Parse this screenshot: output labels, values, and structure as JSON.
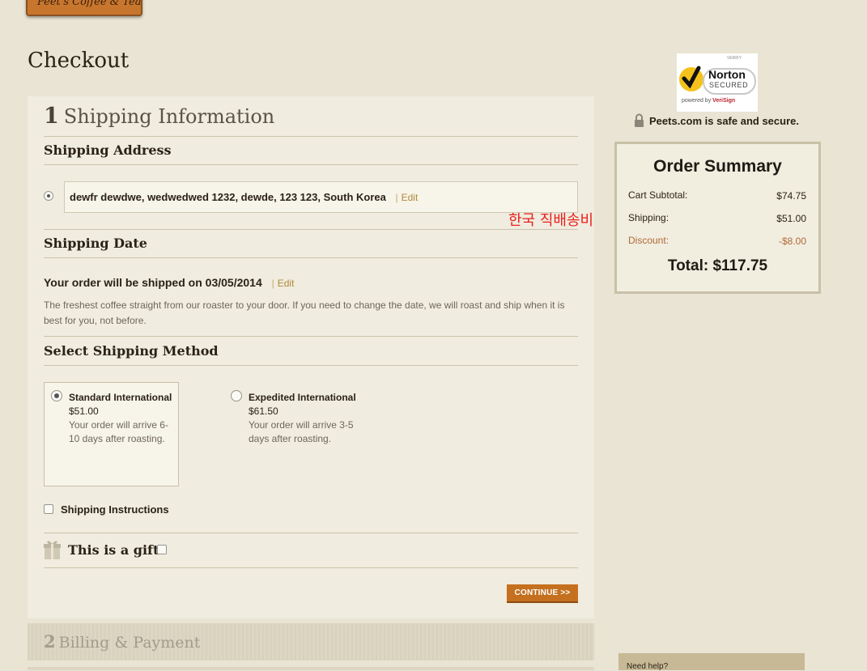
{
  "header": {
    "logo_text": "Peet's Coffee & Tea"
  },
  "page_title": "Checkout",
  "shipping": {
    "step_number": "1",
    "step_title": "Shipping Information",
    "address_heading": "Shipping Address",
    "address_text": "dewfr dewdwe, wedwedwed 1232, dewde, 123 123, South Korea",
    "edit_label": "Edit",
    "edit_separator": "|",
    "annotation": "한국 직배송비",
    "date_heading": "Shipping Date",
    "ship_line_prefix": "Your order will be shipped on",
    "ship_date": "03/05/2014",
    "date_description": "The freshest coffee straight from our roaster to your door. If you need to change the date, we will roast and ship when it is best for you, not before.",
    "method_heading": "Select Shipping Method",
    "methods": [
      {
        "name": "Standard International",
        "price": "$51.00",
        "note": "Your order will arrive 6-10 days after roasting.",
        "selected": true
      },
      {
        "name": "Expedited International",
        "price": "$61.50",
        "note": "Your order will arrive 3-5 days after roasting.",
        "selected": false
      }
    ],
    "instructions_label": "Shipping Instructions",
    "gift_label": "This is a gift",
    "continue_label": "CONTINUE >>"
  },
  "billing": {
    "step_number": "2",
    "step_title": "Billing & Payment"
  },
  "security": {
    "badge_verify": "VERIFY",
    "badge_brand": "Norton",
    "badge_secured": "SECURED",
    "badge_powered": "powered by",
    "badge_verisign": "VeriSign",
    "secure_text": "Peets.com is safe and secure."
  },
  "order_summary": {
    "title": "Order Summary",
    "rows": [
      {
        "label": "Cart Subtotal:",
        "value": "$74.75"
      },
      {
        "label": "Shipping:",
        "value": "$51.00"
      },
      {
        "label": "Discount:",
        "value": "-$8.00"
      }
    ],
    "total_label": "Total:",
    "total_value": "$117.75"
  },
  "help": {
    "label": "Need help?"
  },
  "colors": {
    "accent": "#c4701f",
    "link": "#b08a3a",
    "annotation": "#e8211d",
    "discount": "#b06a3a"
  }
}
